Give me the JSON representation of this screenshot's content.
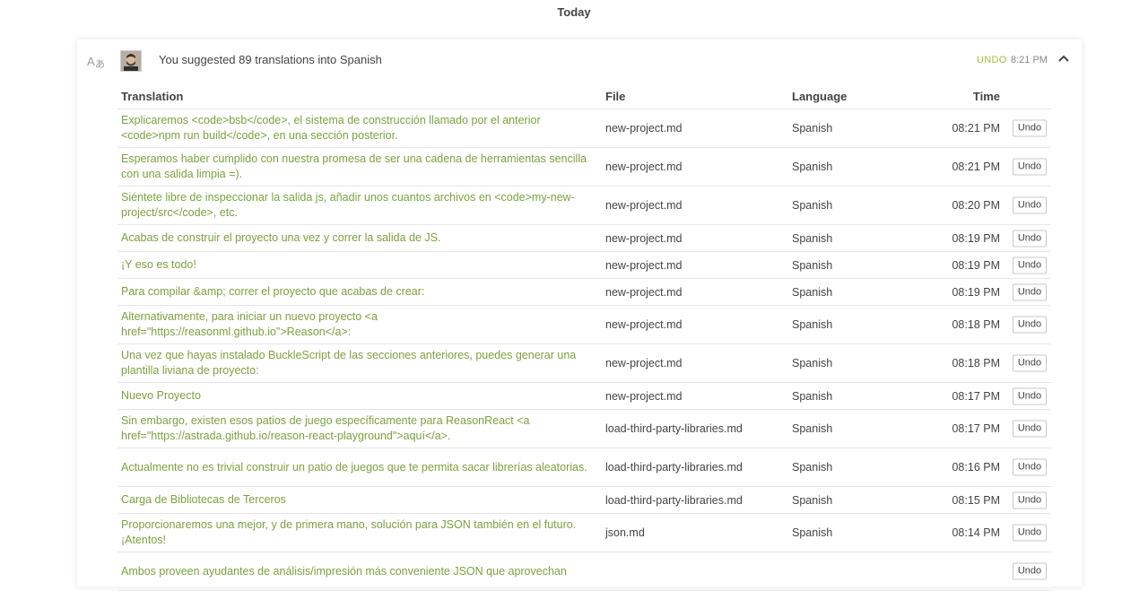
{
  "header": {
    "day_label": "Today"
  },
  "card": {
    "summary": "You suggested 89 translations into Spanish",
    "undo_label": "UNDO",
    "time": "8:21 PM",
    "icons": {
      "translate": "translate-icon",
      "avatar": "user-avatar",
      "collapse": "chevron-up-icon"
    }
  },
  "table": {
    "headers": {
      "translation": "Translation",
      "file": "File",
      "language": "Language",
      "time": "Time"
    },
    "undo_button_label": "Undo",
    "rows": [
      {
        "translation": "Explicaremos <code>bsb</code>, el sistema de construcción llamado por el anterior <code>npm run build</code>, en una sección posterior.",
        "file": "new-project.md",
        "language": "Spanish",
        "time": "08:21 PM",
        "undo": "Undo"
      },
      {
        "translation": "Esperamos haber cumplido con nuestra promesa de ser una cadena de herramientas sencilla con una salida limpia =).",
        "file": "new-project.md",
        "language": "Spanish",
        "time": "08:21 PM",
        "undo": "Undo"
      },
      {
        "translation": "Siéntete libre de inspeccionar la salida js, añadir unos cuantos archivos en <code>my-new-project/src</code>, etc.",
        "file": "new-project.md",
        "language": "Spanish",
        "time": "08:20 PM",
        "undo": "Undo"
      },
      {
        "translation": "Acabas de construir el proyecto una vez y correr la salida de JS.",
        "file": "new-project.md",
        "language": "Spanish",
        "time": "08:19 PM",
        "undo": "Undo"
      },
      {
        "translation": "¡Y eso es todo!",
        "file": "new-project.md",
        "language": "Spanish",
        "time": "08:19 PM",
        "undo": "Undo"
      },
      {
        "translation": "Para compilar &amp; correr el proyecto que acabas de crear:",
        "file": "new-project.md",
        "language": "Spanish",
        "time": "08:19 PM",
        "undo": "Undo"
      },
      {
        "translation": "Alternativamente, para iniciar un nuevo proyecto <a href=\"https://reasonml.github.io\">Reason</a>:",
        "file": "new-project.md",
        "language": "Spanish",
        "time": "08:18 PM",
        "undo": "Undo"
      },
      {
        "translation": "Una vez que hayas instalado BuckleScript de las secciones anteriores, puedes generar una plantilla liviana de proyecto:",
        "file": "new-project.md",
        "language": "Spanish",
        "time": "08:18 PM",
        "undo": "Undo"
      },
      {
        "translation": "Nuevo Proyecto",
        "file": "new-project.md",
        "language": "Spanish",
        "time": "08:17 PM",
        "undo": "Undo"
      },
      {
        "translation": "Sin embargo, existen esos patios de juego específicamente para ReasonReact <a href=\"https://astrada.github.io/reason-react-playground\">aquí</a>.",
        "file": "load-third-party-libraries.md",
        "language": "Spanish",
        "time": "08:17 PM",
        "undo": "Undo"
      },
      {
        "translation": "Actualmente no es trivial construir un patio de juegos que te permita sacar librerías aleatorias.",
        "file": "load-third-party-libraries.md",
        "language": "Spanish",
        "time": "08:16 PM",
        "undo": "Undo"
      },
      {
        "translation": "Carga de Bibliotecas de Terceros",
        "file": "load-third-party-libraries.md",
        "language": "Spanish",
        "time": "08:15 PM",
        "undo": "Undo"
      },
      {
        "translation": "Proporcionaremos una mejor, y de primera mano, solución para JSON también en el futuro. ¡Atentos!",
        "file": "json.md",
        "language": "Spanish",
        "time": "08:14 PM",
        "undo": "Undo"
      },
      {
        "translation": "Ambos proveen ayudantes de análisis/impresión más conveniente JSON que aprovechan",
        "file": "",
        "language": "",
        "time": "",
        "undo": "Undo"
      }
    ]
  }
}
